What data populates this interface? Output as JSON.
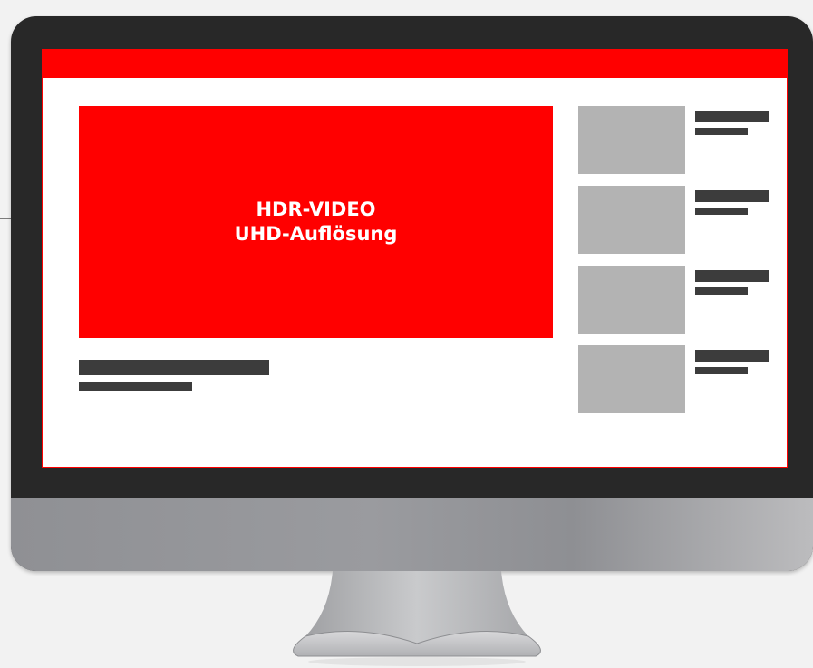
{
  "video": {
    "line1": "HDR-VIDEO",
    "line2": "UHD-Auflösung"
  },
  "colors": {
    "accent": "#ff0000",
    "bezel": "#282828",
    "placeholder_text": "#3c3c3c",
    "thumbnail": "#b3b3b3",
    "background": "#f2f2f2"
  }
}
